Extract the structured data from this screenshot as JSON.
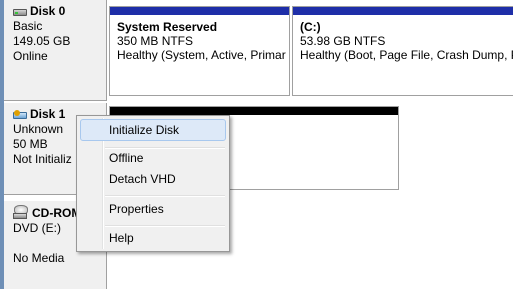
{
  "disks": [
    {
      "title": "Disk 0",
      "type": "Basic",
      "size": "149.05 GB",
      "status": "Online",
      "icon": "hard-disk-icon",
      "partitions": [
        {
          "name": "System Reserved",
          "size": "350 MB NTFS",
          "status": "Healthy (System, Active, Primar"
        },
        {
          "name": "(C:)",
          "size": "53.98 GB NTFS",
          "status": "Healthy (Boot, Page File, Crash Dump, Pri"
        }
      ]
    },
    {
      "title": "Disk 1",
      "type": "Unknown",
      "size": "50 MB",
      "status": "Not Initializ",
      "icon": "virtual-disk-warning-icon"
    },
    {
      "title": "CD-ROM",
      "type": "DVD (E:)",
      "status": "No Media",
      "icon": "cd-rom-icon"
    }
  ],
  "context_menu": {
    "items": [
      "Initialize Disk",
      "Offline",
      "Detach VHD",
      "Properties",
      "Help"
    ],
    "highlighted": "Initialize Disk"
  },
  "colors": {
    "partition_bar": "#1e2ea8",
    "unallocated_bar": "#000000",
    "highlight": "#dde9f8"
  }
}
